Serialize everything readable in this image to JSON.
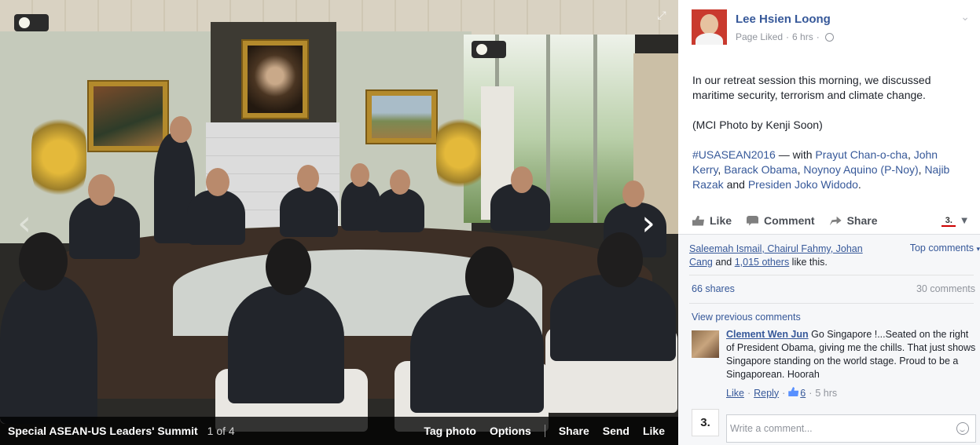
{
  "photo": {
    "album_title": "Special ASEAN-US Leaders' Summit",
    "count": "1 of 4",
    "actions": {
      "tag": "Tag photo",
      "options": "Options",
      "share": "Share",
      "send": "Send",
      "like": "Like"
    },
    "prev_arrow": "‹",
    "next_arrow": "›",
    "expand": "⤢"
  },
  "post": {
    "page_name": "Lee Hsien Loong",
    "status": "Page Liked",
    "time": "6 hrs",
    "text1": "In our retreat session this morning, we discussed maritime security, terrorism and climate change.",
    "text2": "(MCI Photo by Kenji Soon)",
    "hashtag": "#USASEAN2016",
    "with_label": " — with ",
    "tags": {
      "prayut": "Prayut Chan-o-cha",
      "kerry": "John Kerry",
      "obama": "Barack Obama",
      "noynoy": "Noynoy Aquino (P-Noy)",
      "najib": "Najib Razak",
      "and": " and ",
      "jokowi": "Presiden Joko Widodo",
      "end": "."
    }
  },
  "actions": {
    "like": "Like",
    "comment": "Comment",
    "share": "Share",
    "page_logo": "3."
  },
  "likes": {
    "names": "Saleemah Ismail, Chairul Fahmy, Johan Cang",
    "and": " and ",
    "others": "1,015 others",
    "suffix": " like this."
  },
  "top_comments": "Top comments",
  "shares": "66 shares",
  "comments_count": "30 comments",
  "view_previous": "View previous comments",
  "comment": {
    "author": "Clement Wen Jun",
    "text": " Go Singapore !...Seated on the right of President Obama, giving me the chills. That just shows Singapore standing on the world stage. Proud to be a Singaporean. Hoorah",
    "like": "Like",
    "reply": "Reply",
    "likes": "6",
    "time": "5 hrs"
  },
  "write_comment": {
    "placeholder": "Write a comment...",
    "avatar_logo": "3."
  }
}
